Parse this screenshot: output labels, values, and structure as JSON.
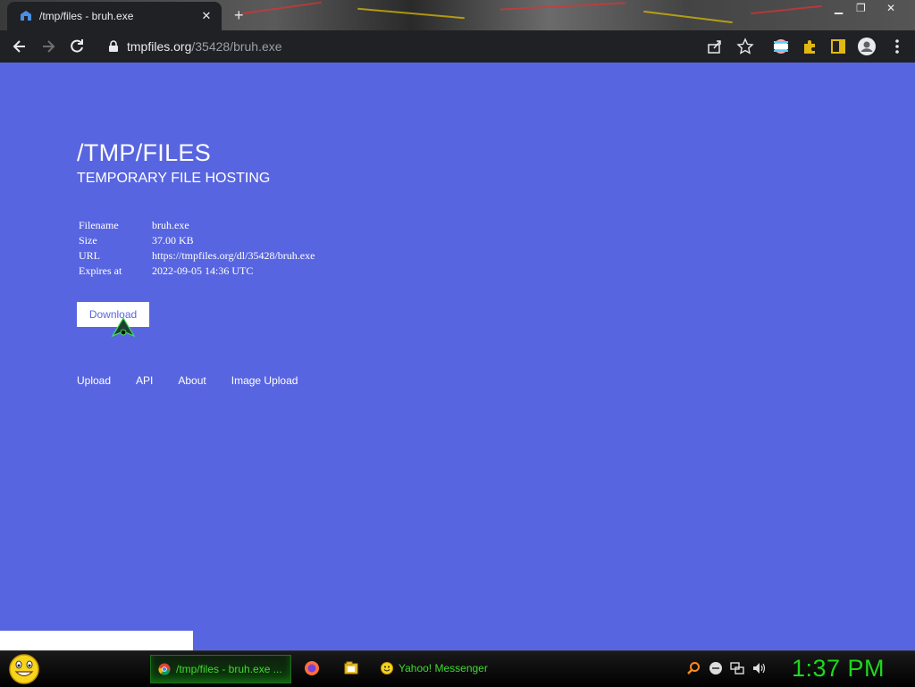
{
  "browser": {
    "tab_title": "/tmp/files - bruh.exe",
    "tab_close": "✕",
    "new_tab": "+",
    "window_controls": {
      "minimize": "▁",
      "maximize": "❐",
      "close": "✕"
    },
    "url_host": "tmpfiles.org",
    "url_path": "/35428/bruh.exe"
  },
  "page": {
    "title": "/TMP/FILES",
    "subtitle": "TEMPORARY FILE HOSTING",
    "meta": [
      {
        "label": "Filename",
        "value": "bruh.exe"
      },
      {
        "label": "Size",
        "value": "37.00 KB"
      },
      {
        "label": "URL",
        "value": "https://tmpfiles.org/dl/35428/bruh.exe"
      },
      {
        "label": "Expires at",
        "value": "2022-09-05 14:36 UTC"
      }
    ],
    "download_label": "Download",
    "nav": [
      "Upload",
      "API",
      "About",
      "Image Upload"
    ]
  },
  "taskbar": {
    "tasks": [
      {
        "label": "/tmp/files - bruh.exe ...",
        "active": true
      },
      {
        "label": "Yahoo! Messenger",
        "active": false
      }
    ],
    "clock": "1:37 PM"
  },
  "colors": {
    "page_bg": "#5865e0",
    "chrome_bg": "#202124",
    "taskbar_green": "#1ed81e"
  }
}
